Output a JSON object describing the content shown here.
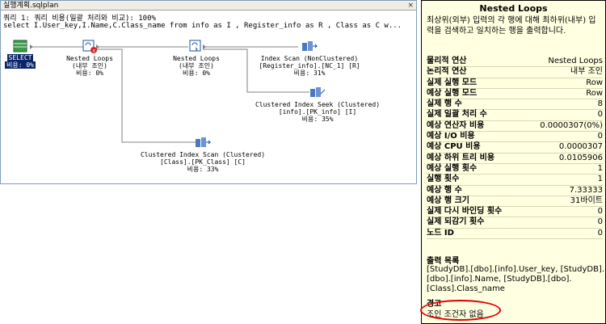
{
  "window": {
    "tab_title": "실행계획.sqlplan",
    "close": "×"
  },
  "query": {
    "header": "쿼리 1: 쿼리 비용(일괄 처리와 비교): 100%",
    "sql": "select I.User_key,I.Name,C.Class_name from info as I , Register_info as R , Class as C w..."
  },
  "plan": {
    "select": {
      "label": "SELECT",
      "cost": "비용: 0%"
    },
    "nl1": {
      "name": "Nested Loops",
      "sub": "(내부 조인)",
      "cost": "비용: 0%"
    },
    "nl2": {
      "name": "Nested Loops",
      "sub": "(내부 조인)",
      "cost": "비용: 0%"
    },
    "idx_scan": {
      "name": "Index Scan (NonClustered)",
      "obj": "[Register_info].[NC_1] [R]",
      "cost": "비용: 31%"
    },
    "ci_seek": {
      "name": "Clustered Index Seek (Clustered)",
      "obj": "[info].[PK_info] [I]",
      "cost": "비용: 35%"
    },
    "ci_scan": {
      "name": "Clustered Index Scan (Clustered)",
      "obj": "[Class].[PK_Class] [C]",
      "cost": "비용: 33%"
    }
  },
  "tooltip": {
    "title": "Nested Loops",
    "description": "최상위(외부) 입력의 각 행에 대해 최하위(내부) 입력을 검색하고 일치하는 행을 출력합니다.",
    "rows": [
      {
        "k": "물리적 연산",
        "v": "Nested Loops"
      },
      {
        "k": "논리적 연산",
        "v": "내부 조인"
      },
      {
        "k": "실제 실행 모드",
        "v": "Row"
      },
      {
        "k": "예상 실행 모드",
        "v": "Row"
      },
      {
        "k": "실제 행 수",
        "v": "8"
      },
      {
        "k": "실제 일괄 처리 수",
        "v": "0"
      },
      {
        "k": "예상 연산자 비용",
        "v": "0.0000307(0%)"
      },
      {
        "k": "예상 I/O 비용",
        "v": "0"
      },
      {
        "k": "예상 CPU 비용",
        "v": "0.0000307"
      },
      {
        "k": "예상 하위 트리 비용",
        "v": "0.0105906"
      },
      {
        "k": "예상 실행 횟수",
        "v": "1"
      },
      {
        "k": "실행 횟수",
        "v": "1"
      },
      {
        "k": "예상 행 수",
        "v": "7.33333"
      },
      {
        "k": "예상 행 크기",
        "v": "31바이트"
      },
      {
        "k": "실제 다시 바인딩 횟수",
        "v": "0"
      },
      {
        "k": "실제 되감기 횟수",
        "v": "0"
      },
      {
        "k": "노드 ID",
        "v": "0"
      }
    ],
    "output_title": "출력 목록",
    "output_list": "[StudyDB].[dbo].[info].User_key, [StudyDB].[dbo].[info].Name, [StudyDB].[dbo].[Class].Class_name",
    "warning_title": "경고",
    "warning_text": "조인 조건자 없음"
  },
  "colors": {
    "tooltip_bg": "#ffffe1",
    "highlight": "#e00000",
    "select_bg": "#0a246a"
  }
}
